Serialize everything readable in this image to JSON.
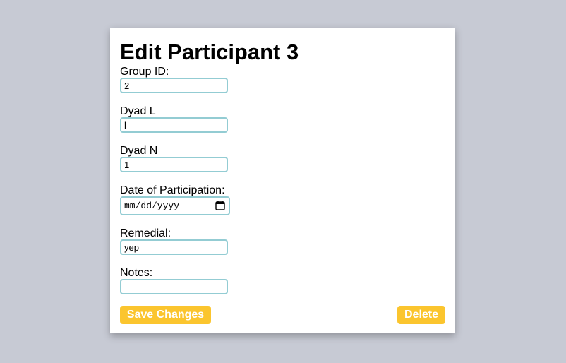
{
  "page": {
    "title": "Edit Participant 3"
  },
  "form": {
    "group_id": {
      "label": "Group ID:",
      "value": "2"
    },
    "dyad_l": {
      "label": "Dyad L",
      "value": "l"
    },
    "dyad_n": {
      "label": "Dyad N",
      "value": "1"
    },
    "date": {
      "label": "Date of Participation:",
      "placeholder": "mm/dd/yyyy",
      "icon": "calendar-icon"
    },
    "remedial": {
      "label": "Remedial:",
      "value": "yep"
    },
    "notes": {
      "label": "Notes:",
      "value": ""
    }
  },
  "actions": {
    "save_label": "Save Changes",
    "delete_label": "Delete"
  },
  "colors": {
    "background": "#c7cad4",
    "card": "#ffffff",
    "input_border": "#93ccd3",
    "button": "#fbc52e",
    "button_text": "#ffffff"
  }
}
